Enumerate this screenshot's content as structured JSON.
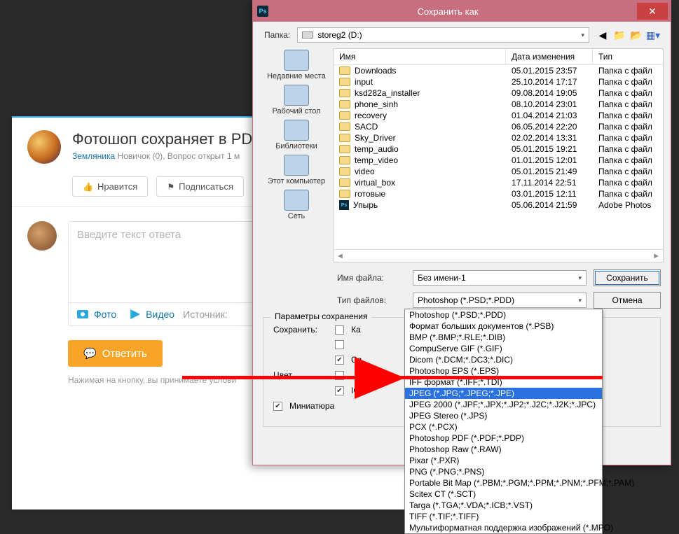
{
  "forum": {
    "title": "Фотошоп сохраняет в PD",
    "author": "Земляника",
    "meta_after": "Новичок (0), Вопрос открыт 1 м",
    "like_btn": "Нравится",
    "subscribe_btn": "Подписаться",
    "editor_placeholder": "Введите текст ответа",
    "photo": "Фото",
    "video": "Видео",
    "source": "Источник:",
    "submit": "Ответить",
    "terms": "Нажимая на кнопку, вы принимаете услови"
  },
  "dialog": {
    "title": "Сохранить как",
    "folder_label": "Папка:",
    "folder_value": "storeg2 (D:)",
    "col_name": "Имя",
    "col_date": "Дата изменения",
    "col_type": "Тип",
    "places": [
      "Недавние места",
      "Рабочий стол",
      "Библиотеки",
      "Этот компьютер",
      "Сеть"
    ],
    "files": [
      {
        "n": "Downloads",
        "d": "05.01.2015 23:57",
        "t": "Папка с файл",
        "k": "folder"
      },
      {
        "n": "input",
        "d": "25.10.2014 17:17",
        "t": "Папка с файл",
        "k": "folder"
      },
      {
        "n": "ksd282a_installer",
        "d": "09.08.2014 19:05",
        "t": "Папка с файл",
        "k": "folder"
      },
      {
        "n": "phone_sinh",
        "d": "08.10.2014 23:01",
        "t": "Папка с файл",
        "k": "folder"
      },
      {
        "n": "recovery",
        "d": "01.04.2014 21:03",
        "t": "Папка с файл",
        "k": "folder"
      },
      {
        "n": "SACD",
        "d": "06.05.2014 22:20",
        "t": "Папка с файл",
        "k": "folder"
      },
      {
        "n": "Sky_Driver",
        "d": "02.02.2014 13:31",
        "t": "Папка с файл",
        "k": "folder"
      },
      {
        "n": "temp_audio",
        "d": "05.01.2015 19:21",
        "t": "Папка с файл",
        "k": "folder"
      },
      {
        "n": "temp_video",
        "d": "01.01.2015 12:01",
        "t": "Папка с файл",
        "k": "folder"
      },
      {
        "n": "video",
        "d": "05.01.2015 21:49",
        "t": "Папка с файл",
        "k": "folder"
      },
      {
        "n": "virtual_box",
        "d": "17.11.2014 22:51",
        "t": "Папка с файл",
        "k": "folder"
      },
      {
        "n": "готовые",
        "d": "03.01.2015 12:11",
        "t": "Папка с файл",
        "k": "folder"
      },
      {
        "n": "Упырь",
        "d": "05.06.2014 21:59",
        "t": "Adobe Photos",
        "k": "psd"
      }
    ],
    "filename_label": "Имя файла:",
    "filename_value": "Без имени-1",
    "type_label": "Тип файлов:",
    "type_value": "Photoshop (*.PSD;*.PDD)",
    "save_btn": "Сохранить",
    "cancel_btn": "Отмена",
    "params_title": "Параметры сохранения",
    "save_param_label": "Сохранить:",
    "chk_ka": "Ка",
    "chk_sa": "Са",
    "color_label": "Цвет",
    "chk_ic": "IC",
    "thumb_label": "Миниатюра",
    "type_options": [
      "Photoshop (*.PSD;*.PDD)",
      "Формат больших документов (*.PSB)",
      "BMP (*.BMP;*.RLE;*.DIB)",
      "CompuServe GIF (*.GIF)",
      "Dicom (*.DCM;*.DC3;*.DIC)",
      "Photoshop EPS (*.EPS)",
      "IFF формат (*.IFF;*.TDI)",
      "JPEG (*.JPG;*.JPEG;*.JPE)",
      "JPEG 2000 (*.JPF;*.JPX;*.JP2;*.J2C;*.J2K;*.JPC)",
      "JPEG Stereo (*.JPS)",
      "PCX (*.PCX)",
      "Photoshop PDF (*.PDF;*.PDP)",
      "Photoshop Raw (*.RAW)",
      "Pixar (*.PXR)",
      "PNG (*.PNG;*.PNS)",
      "Portable Bit Map (*.PBM;*.PGM;*.PPM;*.PNM;*.PFM;*.PAM)",
      "Scitex CT (*.SCT)",
      "Targa (*.TGA;*.VDA;*.ICB;*.VST)",
      "TIFF (*.TIF;*.TIFF)",
      "Мультиформатная поддержка изображений  (*.MPO)"
    ],
    "type_highlight_index": 7
  }
}
